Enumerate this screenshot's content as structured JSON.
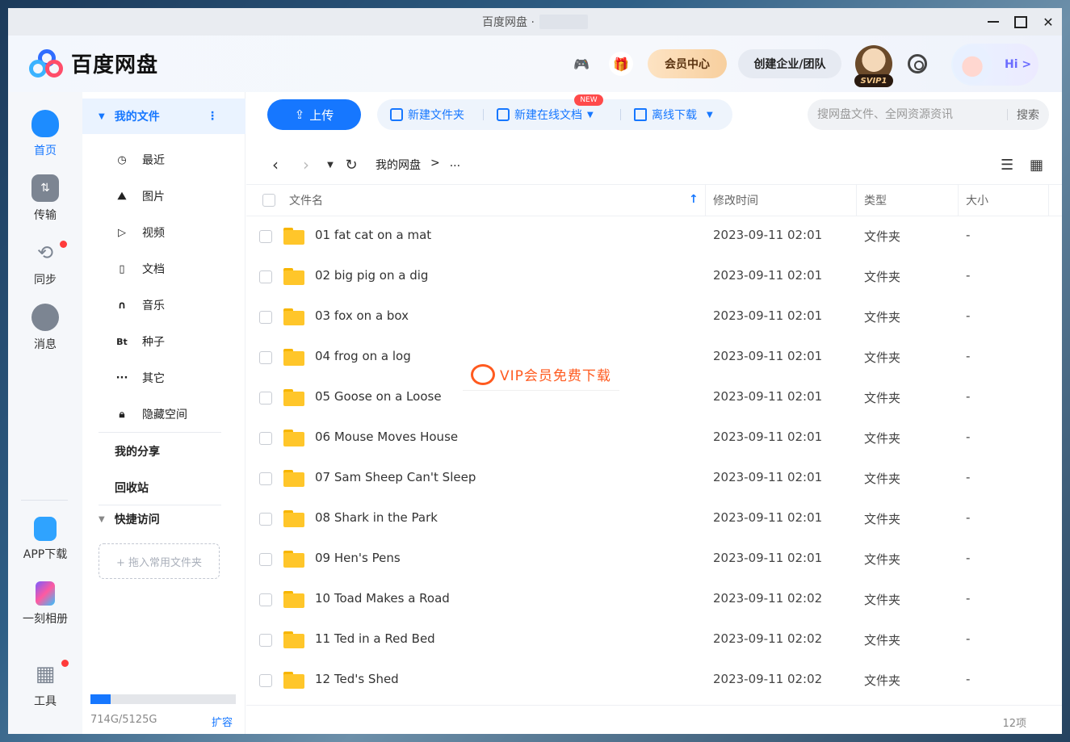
{
  "window": {
    "title": "百度网盘 ·"
  },
  "header": {
    "logo_text": "百度网盘",
    "vip_center": "会员中心",
    "create_enterprise": "创建企业/团队",
    "svip_badge": "SVIP1",
    "hi_text": "Hi >"
  },
  "rail": {
    "items": [
      {
        "label": "首页",
        "icon": "cloud-icon"
      },
      {
        "label": "传输",
        "icon": "transfer-icon"
      },
      {
        "label": "同步",
        "icon": "sync-icon"
      },
      {
        "label": "消息",
        "icon": "message-icon"
      }
    ],
    "bottom": [
      {
        "label": "APP下载",
        "icon": "phone-icon"
      },
      {
        "label": "一刻相册",
        "icon": "album-icon"
      },
      {
        "label": "工具",
        "icon": "tools-icon"
      }
    ]
  },
  "sidebar": {
    "head": "我的文件",
    "items": [
      {
        "label": "最近",
        "icon": "clock-icon"
      },
      {
        "label": "图片",
        "icon": "image-icon"
      },
      {
        "label": "视频",
        "icon": "play-icon"
      },
      {
        "label": "文档",
        "icon": "document-icon"
      },
      {
        "label": "音乐",
        "icon": "headphones-icon"
      },
      {
        "label": "种子",
        "icon": "bt-icon"
      },
      {
        "label": "其它",
        "icon": "more-icon"
      },
      {
        "label": "隐藏空间",
        "icon": "lock-icon"
      }
    ],
    "my_share": "我的分享",
    "recycle": "回收站",
    "quick_access": "快捷访问",
    "drop_zone": "+ 拖入常用文件夹",
    "storage_text": "714G/5125G",
    "storage_used_fraction": 0.139,
    "expand": "扩容"
  },
  "toolbar": {
    "upload": "上传",
    "new_folder": "新建文件夹",
    "new_online_doc": "新建在线文档",
    "new_badge": "NEW",
    "offline_download": "离线下载",
    "search_placeholder": "搜网盘文件、全网资源资讯",
    "search_button": "搜索"
  },
  "nav": {
    "crumbs": [
      "我的网盘",
      ">",
      "..."
    ]
  },
  "table": {
    "headers": {
      "name": "文件名",
      "mtime": "修改时间",
      "type": "类型",
      "size": "大小"
    },
    "rows": [
      {
        "name": "01 fat cat on a mat",
        "mtime": "2023-09-11 02:01",
        "type": "文件夹",
        "size": "-"
      },
      {
        "name": "02 big pig on a dig",
        "mtime": "2023-09-11 02:01",
        "type": "文件夹",
        "size": "-"
      },
      {
        "name": "03 fox on a box",
        "mtime": "2023-09-11 02:01",
        "type": "文件夹",
        "size": "-"
      },
      {
        "name": "04 frog on a log",
        "mtime": "2023-09-11 02:01",
        "type": "文件夹",
        "size": "-"
      },
      {
        "name": "05 Goose on a Loose",
        "mtime": "2023-09-11 02:01",
        "type": "文件夹",
        "size": "-"
      },
      {
        "name": "06 Mouse Moves House",
        "mtime": "2023-09-11 02:01",
        "type": "文件夹",
        "size": "-"
      },
      {
        "name": "07 Sam Sheep Can't Sleep",
        "mtime": "2023-09-11 02:01",
        "type": "文件夹",
        "size": "-"
      },
      {
        "name": "08 Shark in the Park",
        "mtime": "2023-09-11 02:01",
        "type": "文件夹",
        "size": "-"
      },
      {
        "name": "09 Hen's Pens",
        "mtime": "2023-09-11 02:01",
        "type": "文件夹",
        "size": "-"
      },
      {
        "name": "10 Toad Makes a Road",
        "mtime": "2023-09-11 02:02",
        "type": "文件夹",
        "size": "-"
      },
      {
        "name": "11 Ted in a Red Bed",
        "mtime": "2023-09-11 02:02",
        "type": "文件夹",
        "size": "-"
      },
      {
        "name": "12 Ted's Shed",
        "mtime": "2023-09-11 02:02",
        "type": "文件夹",
        "size": "-"
      }
    ],
    "count": "12项"
  },
  "watermark": {
    "text": "VIP会员免费下载"
  },
  "colors": {
    "accent": "#1677ff",
    "folder": "#ffc62a",
    "badge_red": "#ff4a4a",
    "watermark": "#ff5a1f"
  }
}
